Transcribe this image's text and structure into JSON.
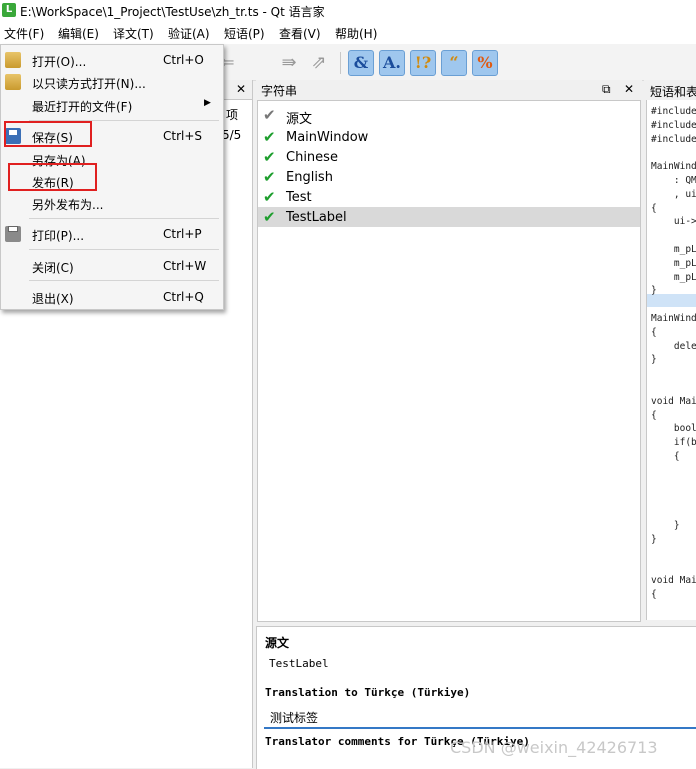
{
  "window": {
    "title": "E:\\WorkSpace\\1_Project\\TestUse\\zh_tr.ts - Qt 语言家",
    "app_icon": "L"
  },
  "menubar": [
    "文件(F)",
    "编辑(E)",
    "译文(T)",
    "验证(A)",
    "短语(P)",
    "查看(V)",
    "帮助(H)"
  ],
  "toolbar": {
    "icons": [
      "undo-icon",
      "redo-icon",
      "accelerator-check-icon",
      "ending-punctuation-check-icon",
      "phrase-match-check-icon",
      "quotes-check-icon",
      "placemarker-check-icon"
    ],
    "glyphs": {
      "accelerator": "&",
      "ending": "A.",
      "phrase": "!?",
      "quotes": "“",
      "placemarker": "%"
    }
  },
  "file_menu": {
    "items": [
      {
        "label": "打开(O)...",
        "shortcut": "Ctrl+O",
        "icon": "folder-open-icon"
      },
      {
        "label": "以只读方式打开(N)...",
        "shortcut": "",
        "icon": "folder-readonly-icon"
      },
      {
        "label": "最近打开的文件(F)",
        "shortcut": "",
        "submenu": true
      },
      {
        "label": "保存(S)",
        "shortcut": "Ctrl+S",
        "icon": "save-icon"
      },
      {
        "label": "另存为(A)...",
        "shortcut": ""
      },
      {
        "label": "发布(R)",
        "shortcut": ""
      },
      {
        "label": "另外发布为...",
        "shortcut": ""
      },
      {
        "label": "打印(P)...",
        "shortcut": "Ctrl+P",
        "icon": "print-icon"
      },
      {
        "label": "关闭(C)",
        "shortcut": "Ctrl+W"
      },
      {
        "label": "退出(X)",
        "shortcut": "Ctrl+Q"
      }
    ]
  },
  "context_dock": {
    "header_partial": "项",
    "count": "5/5"
  },
  "strings_dock": {
    "title": "字符串",
    "float_icon": "⧉",
    "close_icon": "✕",
    "rows": [
      {
        "check": "✔",
        "label": "源文",
        "state": "header"
      },
      {
        "check": "✔",
        "label": "MainWindow",
        "state": "done"
      },
      {
        "check": "✔",
        "label": "Chinese",
        "state": "done"
      },
      {
        "check": "✔",
        "label": "English",
        "state": "done"
      },
      {
        "check": "✔",
        "label": "Test",
        "state": "done"
      },
      {
        "check": "✔",
        "label": "TestLabel",
        "state": "selected"
      }
    ]
  },
  "code_dock": {
    "title": "短语和表",
    "lines": [
      "#include",
      "#include",
      "#include",
      "",
      "MainWind",
      "    : QM",
      "    , ui",
      "{",
      "    ui->",
      "",
      "    m_pL",
      "    m_pL",
      "    m_pL",
      "}",
      "",
      "MainWind",
      "{",
      "    dele",
      "}",
      "",
      "",
      "void Mai",
      "{",
      "    bool",
      "    if(b",
      "    {",
      "",
      "",
      "",
      "",
      "    }",
      "}",
      "",
      "",
      "void Mai",
      "{"
    ]
  },
  "editor": {
    "source_heading": "源文",
    "source_text": "TestLabel",
    "translation_heading": "Translation to Türkçe (Türkiye)",
    "translation_text": "测试标签",
    "comments_heading": "Translator comments for Türkçe (Türkiye)"
  },
  "watermark": "CSDN @weixin_42426713",
  "colors": {
    "check_green": "#1e9e2e",
    "check_gray": "#777777",
    "highlight_red": "#e02020",
    "selection": "#d9d9d9",
    "focus_blue": "#3478c6"
  }
}
